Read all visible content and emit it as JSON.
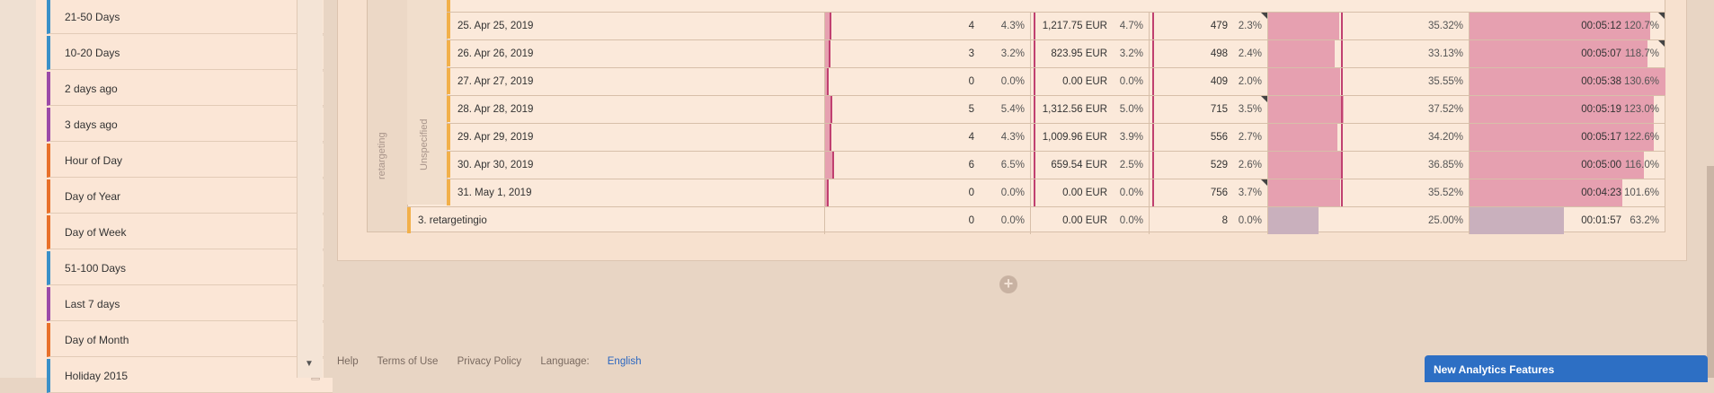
{
  "sidebar": {
    "items": [
      {
        "label": "21-50 Days",
        "color": "#3a90c8",
        "icon": "range-icon"
      },
      {
        "label": "10-20 Days",
        "color": "#3a90c8",
        "icon": "range-icon"
      },
      {
        "label": "2 days ago",
        "color": "#9c4aa8",
        "icon": "clock-icon"
      },
      {
        "label": "3 days ago",
        "color": "#9c4aa8",
        "icon": "clock-icon"
      },
      {
        "label": "Hour of Day",
        "color": "#e8702a",
        "icon": "stack-icon"
      },
      {
        "label": "Day of Year",
        "color": "#e8702a",
        "icon": "stack-icon"
      },
      {
        "label": "Day of Week",
        "color": "#e8702a",
        "icon": "stack-icon"
      },
      {
        "label": "51-100 Days",
        "color": "#3a90c8",
        "icon": "range-icon"
      },
      {
        "label": "Last 7 days",
        "color": "#9c4aa8",
        "icon": "clock-icon"
      },
      {
        "label": "Day of Month",
        "color": "#e8702a",
        "icon": "stack-icon"
      },
      {
        "label": "Holiday 2015",
        "color": "#3a90c8",
        "icon": "range-icon"
      }
    ]
  },
  "table": {
    "segment_outer": "retargeting",
    "segment_inner": "Unspecified",
    "rows": [
      {
        "label": "25.  Apr 25, 2019",
        "orders": "4",
        "orders_pct": "4.3%",
        "rev": "1,217.75 EUR",
        "rev_pct": "4.7%",
        "visits": "479",
        "visits_pct": "2.3%",
        "bounce": "35.32%",
        "time": "00:05:12",
        "time_pct": "120.7%",
        "orders_frac": 0.043,
        "bounce_frac": 0.3532,
        "time_frac": 1.207
      },
      {
        "label": "26.  Apr 26, 2019",
        "orders": "3",
        "orders_pct": "3.2%",
        "rev": "823.95 EUR",
        "rev_pct": "3.2%",
        "visits": "498",
        "visits_pct": "2.4%",
        "bounce": "33.13%",
        "time": "00:05:07",
        "time_pct": "118.7%",
        "orders_frac": 0.032,
        "bounce_frac": 0.3313,
        "time_frac": 1.187
      },
      {
        "label": "27.  Apr 27, 2019",
        "orders": "0",
        "orders_pct": "0.0%",
        "rev": "0.00 EUR",
        "rev_pct": "0.0%",
        "visits": "409",
        "visits_pct": "2.0%",
        "bounce": "35.55%",
        "time": "00:05:38",
        "time_pct": "130.6%",
        "orders_frac": 0.0,
        "bounce_frac": 0.3555,
        "time_frac": 1.306
      },
      {
        "label": "28.  Apr 28, 2019",
        "orders": "5",
        "orders_pct": "5.4%",
        "rev": "1,312.56 EUR",
        "rev_pct": "5.0%",
        "visits": "715",
        "visits_pct": "3.5%",
        "bounce": "37.52%",
        "time": "00:05:19",
        "time_pct": "123.0%",
        "orders_frac": 0.054,
        "bounce_frac": 0.3752,
        "time_frac": 1.23
      },
      {
        "label": "29.  Apr 29, 2019",
        "orders": "4",
        "orders_pct": "4.3%",
        "rev": "1,009.96 EUR",
        "rev_pct": "3.9%",
        "visits": "556",
        "visits_pct": "2.7%",
        "bounce": "34.20%",
        "time": "00:05:17",
        "time_pct": "122.6%",
        "orders_frac": 0.043,
        "bounce_frac": 0.342,
        "time_frac": 1.226
      },
      {
        "label": "30.  Apr 30, 2019",
        "orders": "6",
        "orders_pct": "6.5%",
        "rev": "659.54 EUR",
        "rev_pct": "2.5%",
        "visits": "529",
        "visits_pct": "2.6%",
        "bounce": "36.85%",
        "time": "00:05:00",
        "time_pct": "116.0%",
        "orders_frac": 0.065,
        "bounce_frac": 0.3685,
        "time_frac": 1.16
      },
      {
        "label": "31.  May 1, 2019",
        "orders": "0",
        "orders_pct": "0.0%",
        "rev": "0.00 EUR",
        "rev_pct": "0.0%",
        "visits": "756",
        "visits_pct": "3.7%",
        "bounce": "35.52%",
        "time": "00:04:23",
        "time_pct": "101.6%",
        "orders_frac": 0.0,
        "bounce_frac": 0.3552,
        "time_frac": 1.016
      }
    ],
    "summary_row": {
      "label": "3.  retargetingio",
      "orders": "0",
      "orders_pct": "0.0%",
      "rev": "0.00 EUR",
      "rev_pct": "0.0%",
      "visits": "8",
      "visits_pct": "0.0%",
      "bounce": "25.00%",
      "time": "00:01:57",
      "time_pct": "63.2%",
      "bounce_frac": 0.25,
      "time_frac": 0.632
    }
  },
  "footer": {
    "help": "Help",
    "terms": "Terms of Use",
    "privacy": "Privacy Policy",
    "language_label": "Language:",
    "language_value": "English"
  },
  "toast": {
    "title": "New Analytics Features"
  },
  "colors": {
    "bar": "#e6a0b0",
    "bar_summary": "#c9b0bd",
    "accent": "#f2b04a",
    "link": "#2a66c0"
  }
}
